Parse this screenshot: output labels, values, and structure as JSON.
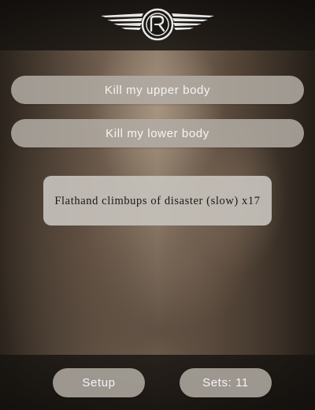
{
  "header": {
    "logo_icon": "winged-rk-emblem-icon"
  },
  "main": {
    "upper_body_label": "Kill my upper body",
    "lower_body_label": "Kill my lower body",
    "exercise_text": "Flathand climbups of disaster (slow) x17"
  },
  "footer": {
    "setup_label": "Setup",
    "sets_label": "Sets: 11"
  },
  "colors": {
    "button_bg": "#b2aca4",
    "card_bg": "#c6c1bb",
    "bar_bg": "#14110e"
  }
}
